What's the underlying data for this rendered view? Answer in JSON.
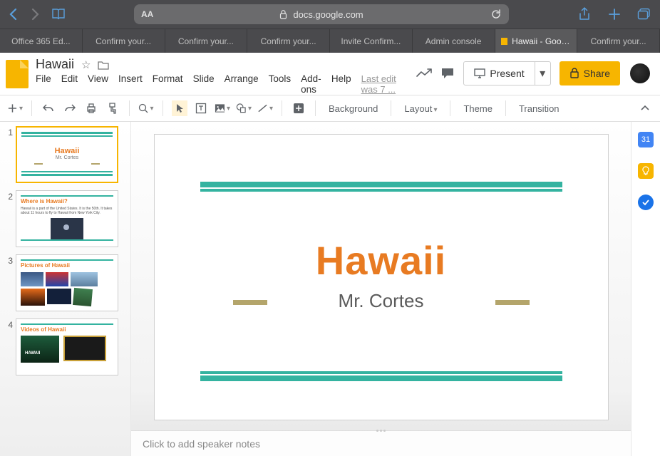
{
  "browser": {
    "url_host": "docs.google.com",
    "font_size_label": "AA",
    "tabs": [
      {
        "label": "Office 365 Ed..."
      },
      {
        "label": "Confirm your..."
      },
      {
        "label": "Confirm your..."
      },
      {
        "label": "Confirm your..."
      },
      {
        "label": "Invite Confirm..."
      },
      {
        "label": "Admin console"
      },
      {
        "label": "Hawaii - Goog...",
        "active": true
      },
      {
        "label": "Confirm your..."
      }
    ]
  },
  "doc": {
    "title": "Hawaii",
    "last_edit": "Last edit was 7 ...",
    "menus": [
      "File",
      "Edit",
      "View",
      "Insert",
      "Format",
      "Slide",
      "Arrange",
      "Tools",
      "Add-ons",
      "Help"
    ],
    "present_label": "Present",
    "share_label": "Share"
  },
  "toolbar": {
    "background": "Background",
    "layout": "Layout",
    "theme": "Theme",
    "transition": "Transition"
  },
  "slides": [
    {
      "num": "1",
      "title": "Hawaii",
      "subtitle": "Mr. Cortes"
    },
    {
      "num": "2",
      "title": "Where is Hawaii?",
      "body": "Hawaii is a part of the United States. It is the 50th. It takes about 11 hours to fly to Hawaii from New York City."
    },
    {
      "num": "3",
      "title": "Pictures of Hawaii"
    },
    {
      "num": "4",
      "title": "Videos of Hawaii"
    }
  ],
  "main_slide": {
    "title": "Hawaii",
    "subtitle": "Mr. Cortes"
  },
  "notes_placeholder": "Click to add speaker notes"
}
